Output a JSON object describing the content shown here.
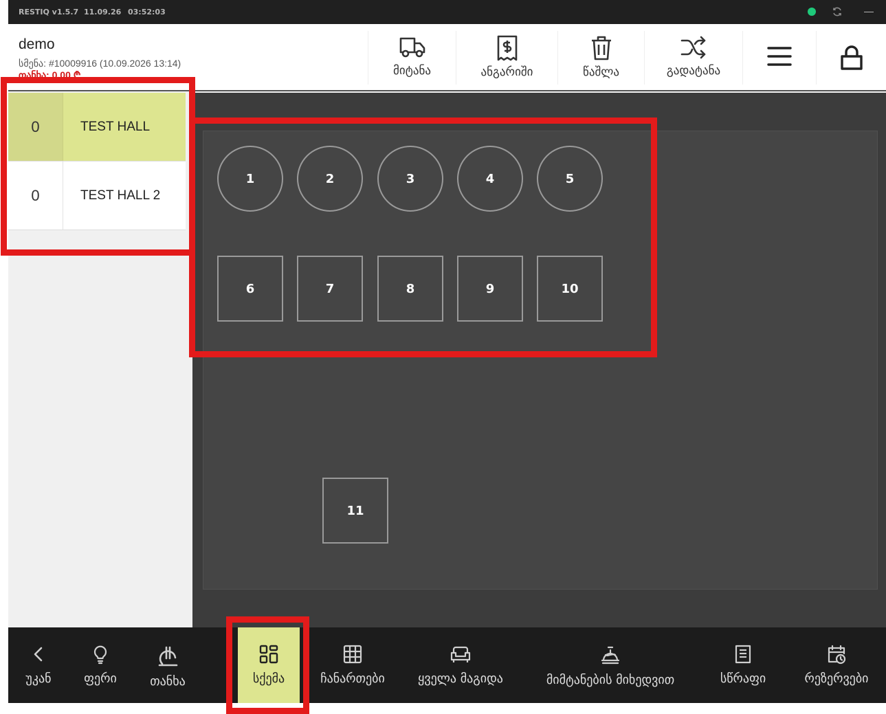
{
  "titlebar": {
    "app_version": "RESTIQ v1.5.7",
    "date": "11.09.26",
    "time": "03:52:03"
  },
  "header": {
    "user_name": "demo",
    "shift": "სმენა: #10009916 (10.09.2026 13:14)",
    "total": "თანხა: 0.00 ₾",
    "buttons": [
      {
        "label": "მიტანა",
        "icon": "truck-icon"
      },
      {
        "label": "ანგარიში",
        "icon": "receipt-icon"
      },
      {
        "label": "წაშლა",
        "icon": "trash-icon"
      },
      {
        "label": "გადატანა",
        "icon": "shuffle-icon"
      }
    ]
  },
  "halls": [
    {
      "count": "0",
      "name": "TEST HALL",
      "active": true
    },
    {
      "count": "0",
      "name": "TEST HALL 2",
      "active": false
    }
  ],
  "tables": [
    "1",
    "2",
    "3",
    "4",
    "5",
    "6",
    "7",
    "8",
    "9",
    "10",
    "11"
  ],
  "bottom_nav": [
    {
      "label": "უკან",
      "icon": "chevron-left-icon"
    },
    {
      "label": "ფერი",
      "icon": "lightbulb-icon"
    },
    {
      "label": "თანხა",
      "icon": "lari-icon"
    },
    {
      "label": "სქემა",
      "icon": "layout-grid-icon",
      "active": true
    },
    {
      "label": "ჩანართები",
      "icon": "table-grid-icon"
    },
    {
      "label": "ყველა მაგიდა",
      "icon": "sofa-icon"
    },
    {
      "label": "მიმტანების მიხედვით",
      "icon": "waiter-icon"
    },
    {
      "label": "სწრაფი",
      "icon": "document-icon"
    },
    {
      "label": "რეზერვები",
      "icon": "calendar-clock-icon"
    }
  ],
  "colors": {
    "accent": "#dde590",
    "highlight": "#e31b1b",
    "floor": "#454545",
    "status_online": "#1ec97a"
  }
}
